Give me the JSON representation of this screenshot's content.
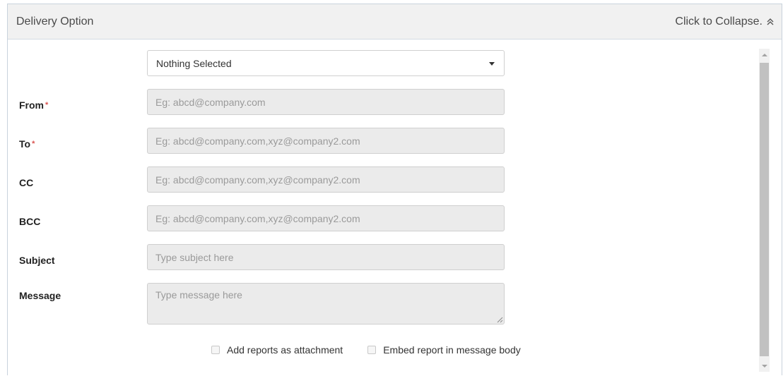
{
  "panel": {
    "title": "Delivery Option",
    "collapse_label": "Click to Collapse.",
    "collapse_icon": "double-chevron-up-icon"
  },
  "select": {
    "value": "Nothing Selected",
    "icon": "caret-down-icon"
  },
  "fields": {
    "from": {
      "label": "From",
      "required": "*",
      "placeholder": "Eg: abcd@company.com"
    },
    "to": {
      "label": "To",
      "required": "*",
      "placeholder": "Eg: abcd@company.com,xyz@company2.com"
    },
    "cc": {
      "label": "CC",
      "placeholder": "Eg: abcd@company.com,xyz@company2.com"
    },
    "bcc": {
      "label": "BCC",
      "placeholder": "Eg: abcd@company.com,xyz@company2.com"
    },
    "subject": {
      "label": "Subject",
      "placeholder": "Type subject here"
    },
    "message": {
      "label": "Message",
      "placeholder": "Type message here"
    }
  },
  "options": {
    "attachment_label": "Add reports as attachment",
    "embed_label": "Embed report in message body"
  },
  "colors": {
    "header_bg": "#f1f1f1",
    "input_bg": "#ebebeb",
    "required": "#d9534f",
    "border": "#c9d2dc"
  }
}
